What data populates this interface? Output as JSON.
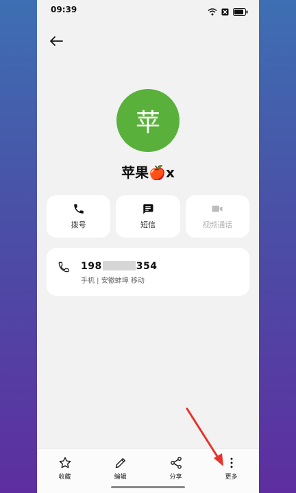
{
  "status": {
    "time": "09:39",
    "icons": [
      "wifi-icon",
      "sim-blocked-icon",
      "battery-icon"
    ]
  },
  "header": {
    "back_icon": "arrow-left-icon"
  },
  "contact": {
    "avatar_text": "苹",
    "avatar_color": "#59b13b",
    "name": "苹果🍎x"
  },
  "actions": [
    {
      "label": "拨号",
      "icon": "phone-icon",
      "enabled": true
    },
    {
      "label": "短信",
      "icon": "message-icon",
      "enabled": true
    },
    {
      "label": "视频通话",
      "icon": "video-icon",
      "enabled": false
    }
  ],
  "phone_entry": {
    "number_prefix": "198",
    "number_suffix": "354",
    "meta": "手机 | 安徽蚌埠 移动"
  },
  "bottom_bar": [
    {
      "label": "收藏",
      "icon": "star-icon"
    },
    {
      "label": "编辑",
      "icon": "pencil-icon"
    },
    {
      "label": "分享",
      "icon": "share-icon"
    },
    {
      "label": "更多",
      "icon": "more-vertical-icon"
    }
  ],
  "annotation": {
    "arrow_color": "#e8322c"
  }
}
